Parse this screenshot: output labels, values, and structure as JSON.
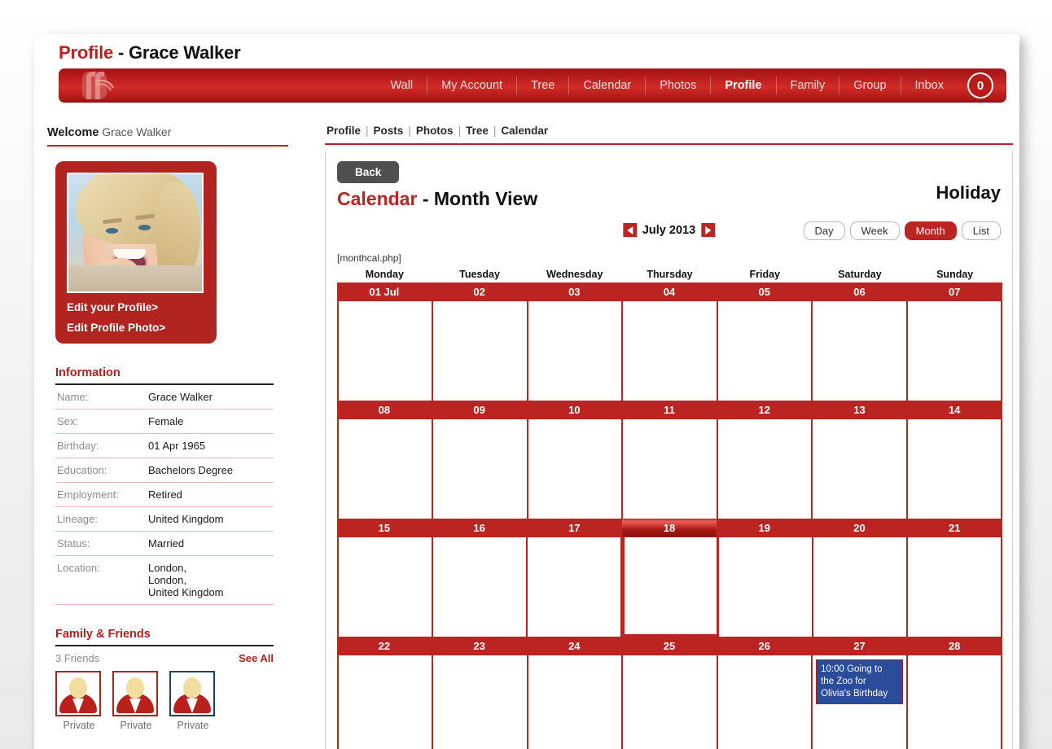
{
  "header": {
    "title_accent": "Profile",
    "title_rest": " - Grace Walker",
    "logo_icon": "ff-logo-icon"
  },
  "nav": {
    "items": [
      {
        "label": "Wall",
        "active": false
      },
      {
        "label": "My Account",
        "active": false
      },
      {
        "label": "Tree",
        "active": false
      },
      {
        "label": "Calendar",
        "active": false
      },
      {
        "label": "Photos",
        "active": false
      },
      {
        "label": "Profile",
        "active": true
      },
      {
        "label": "Family",
        "active": false
      },
      {
        "label": "Group",
        "active": false
      },
      {
        "label": "Inbox",
        "active": false
      }
    ],
    "inbox_count": "0"
  },
  "sidebar": {
    "welcome_label": "Welcome",
    "welcome_name": "Grace Walker",
    "edit_profile": "Edit your Profile>",
    "edit_photo": "Edit Profile Photo>",
    "information_heading": "Information",
    "information": [
      {
        "key": "Name:",
        "value": "Grace Walker"
      },
      {
        "key": "Sex:",
        "value": "Female"
      },
      {
        "key": "Birthday:",
        "value": "01 Apr 1965"
      },
      {
        "key": "Education:",
        "value": "Bachelors Degree"
      },
      {
        "key": "Employment:",
        "value": "Retired"
      },
      {
        "key": "Lineage:",
        "value": "United Kingdom"
      },
      {
        "key": "Status:",
        "value": "Married"
      },
      {
        "key": "Location:",
        "value": "London,\nLondon,\nUnited Kingdom"
      }
    ],
    "friends_heading": "Family & Friends",
    "friends_count": "3 Friends",
    "see_all": "See All",
    "friends": [
      {
        "name": "Private",
        "border": "red"
      },
      {
        "name": "Private",
        "border": "red"
      },
      {
        "name": "Private",
        "border": "blue"
      }
    ]
  },
  "subnav": {
    "items": [
      "Profile",
      "Posts",
      "Photos",
      "Tree",
      "Calendar"
    ]
  },
  "main": {
    "back_button": "Back",
    "title_accent": "Calendar",
    "title_rest": " - Month View",
    "holiday_label": "Holiday",
    "month_label": "July 2013",
    "prev_icon": "arrow-left-icon",
    "next_icon": "arrow-right-icon",
    "php_tag": "[monthcal.php]",
    "view_buttons": [
      {
        "label": "Day",
        "active": false
      },
      {
        "label": "Week",
        "active": false
      },
      {
        "label": "Month",
        "active": true
      },
      {
        "label": "List",
        "active": false
      }
    ]
  },
  "calendar": {
    "day_names": [
      "Monday",
      "Tuesday",
      "Wednesday",
      "Thursday",
      "Friday",
      "Saturday",
      "Sunday"
    ],
    "weeks": [
      {
        "days": [
          {
            "label": "01 Jul",
            "today": false,
            "events": []
          },
          {
            "label": "02",
            "today": false,
            "events": []
          },
          {
            "label": "03",
            "today": false,
            "events": []
          },
          {
            "label": "04",
            "today": false,
            "events": []
          },
          {
            "label": "05",
            "today": false,
            "events": []
          },
          {
            "label": "06",
            "today": false,
            "events": []
          },
          {
            "label": "07",
            "today": false,
            "events": []
          }
        ]
      },
      {
        "days": [
          {
            "label": "08",
            "today": false,
            "events": []
          },
          {
            "label": "09",
            "today": false,
            "events": []
          },
          {
            "label": "10",
            "today": false,
            "events": []
          },
          {
            "label": "11",
            "today": false,
            "events": []
          },
          {
            "label": "12",
            "today": false,
            "events": []
          },
          {
            "label": "13",
            "today": false,
            "events": []
          },
          {
            "label": "14",
            "today": false,
            "events": []
          }
        ]
      },
      {
        "days": [
          {
            "label": "15",
            "today": false,
            "events": []
          },
          {
            "label": "16",
            "today": false,
            "events": []
          },
          {
            "label": "17",
            "today": false,
            "events": []
          },
          {
            "label": "18",
            "today": true,
            "events": []
          },
          {
            "label": "19",
            "today": false,
            "events": []
          },
          {
            "label": "20",
            "today": false,
            "events": []
          },
          {
            "label": "21",
            "today": false,
            "events": []
          }
        ]
      },
      {
        "days": [
          {
            "label": "22",
            "today": false,
            "events": []
          },
          {
            "label": "23",
            "today": false,
            "events": []
          },
          {
            "label": "24",
            "today": false,
            "events": []
          },
          {
            "label": "25",
            "today": false,
            "events": []
          },
          {
            "label": "26",
            "today": false,
            "events": []
          },
          {
            "label": "27",
            "today": false,
            "events": [
              {
                "text": "10:00  Going to the Zoo for Olivia's Birthday"
              }
            ]
          },
          {
            "label": "28",
            "today": false,
            "events": []
          }
        ]
      }
    ]
  },
  "colors": {
    "brand_red": "#bb2420",
    "dark_red": "#8c1210",
    "event_blue": "#2b4b9b",
    "back_gray": "#4f4f4f",
    "friend_blue_border": "#18455f"
  }
}
